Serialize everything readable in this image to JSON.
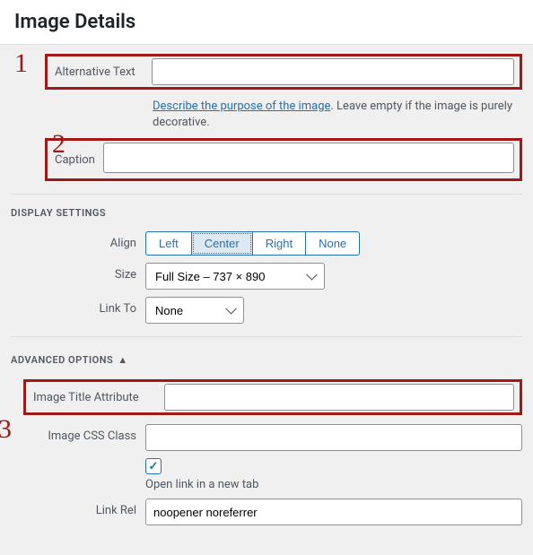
{
  "header": {
    "title": "Image Details"
  },
  "markers": {
    "one": "1",
    "two": "2",
    "three": "3"
  },
  "alt": {
    "label": "Alternative Text",
    "value": "",
    "help_link": "Describe the purpose of the image",
    "help_suffix": ". Leave empty if the image is purely decorative."
  },
  "caption": {
    "label": "Caption",
    "value": ""
  },
  "display": {
    "heading": "DISPLAY SETTINGS",
    "align": {
      "label": "Align",
      "options": [
        "Left",
        "Center",
        "Right",
        "None"
      ],
      "selected": "Center"
    },
    "size": {
      "label": "Size",
      "value": "Full Size – 737 × 890"
    },
    "linkto": {
      "label": "Link To",
      "value": "None"
    }
  },
  "advanced": {
    "heading": "ADVANCED OPTIONS",
    "expanded": true,
    "title_attr": {
      "label": "Image Title Attribute",
      "value": ""
    },
    "css_class": {
      "label": "Image CSS Class",
      "value": ""
    },
    "newtab": {
      "checked": true,
      "label": "Open link in a new tab"
    },
    "linkrel": {
      "label": "Link Rel",
      "value": "noopener noreferrer"
    }
  }
}
